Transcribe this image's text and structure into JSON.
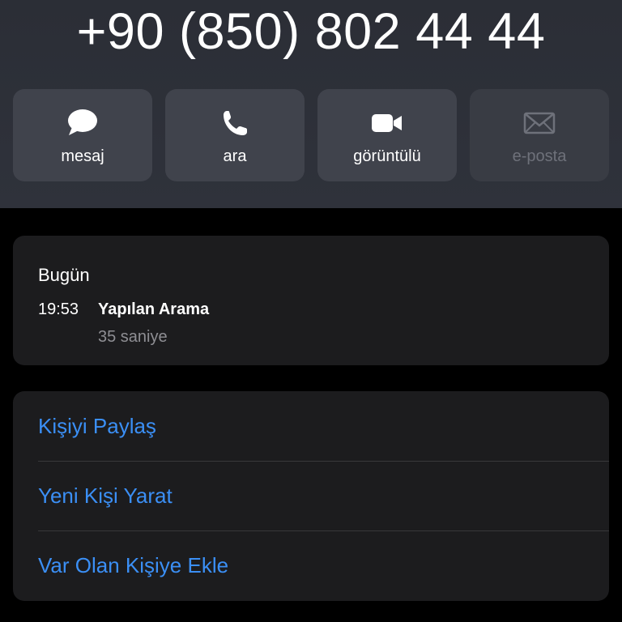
{
  "contact": {
    "phone_number": "+90 (850) 802 44 44"
  },
  "actions": [
    {
      "label": "mesaj",
      "icon": "message-bubble-icon",
      "enabled": true
    },
    {
      "label": "ara",
      "icon": "phone-icon",
      "enabled": true
    },
    {
      "label": "görüntülü",
      "icon": "video-camera-icon",
      "enabled": true
    },
    {
      "label": "e-posta",
      "icon": "envelope-icon",
      "enabled": false
    }
  ],
  "recents": {
    "day": "Bugün",
    "calls": [
      {
        "time": "19:53",
        "type": "Yapılan Arama",
        "duration": "35 saniye"
      }
    ]
  },
  "menu": {
    "items": [
      {
        "label": "Kişiyi Paylaş"
      },
      {
        "label": "Yeni Kişi Yarat"
      },
      {
        "label": "Var Olan Kişiye Ekle"
      }
    ]
  },
  "colors": {
    "background": "#000000",
    "header": "#2e3139",
    "action_button": "#40434c",
    "card": "#1c1c1e",
    "accent_link": "#3b8ff5",
    "secondary_text": "#8e8e93",
    "disabled_text": "#6e717a"
  }
}
